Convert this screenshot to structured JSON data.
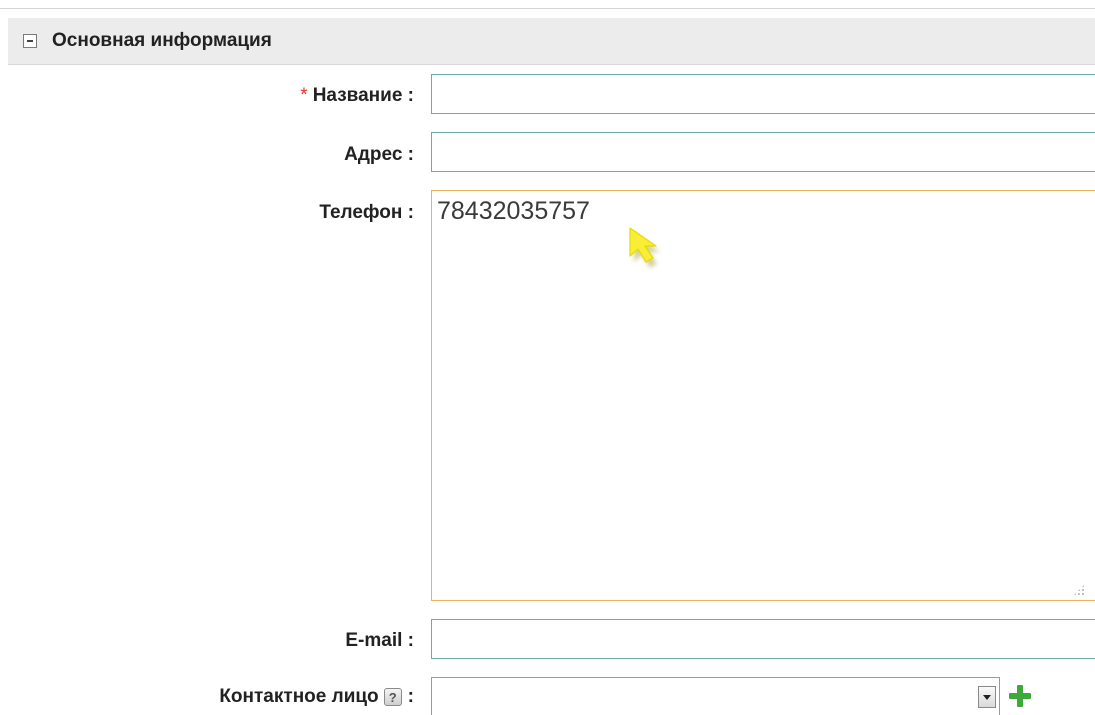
{
  "section": {
    "title": "Основная информация"
  },
  "fields": {
    "name": {
      "required_mark": "*",
      "label": "Название :",
      "value": ""
    },
    "address": {
      "label": "Адрес :",
      "value": ""
    },
    "phone": {
      "label": "Телефон :",
      "value": "78432035757"
    },
    "email": {
      "label": "E-mail :",
      "value": ""
    },
    "contact": {
      "label": "Контактное лицо",
      "help_glyph": "?",
      "label_suffix": ":",
      "selected_value": ""
    }
  },
  "icons": {
    "collapse": "minus-square-icon",
    "help": "question-mark-icon",
    "add": "plus-icon",
    "dropdown": "chevron-down-icon",
    "cursor": "mouse-pointer-icon"
  },
  "colors": {
    "required": "#e0342b",
    "input_border": "#70aaa8",
    "focus_border": "#e9b25c",
    "add_green": "#3ea83a",
    "cursor_yellow": "#f7ee35"
  }
}
